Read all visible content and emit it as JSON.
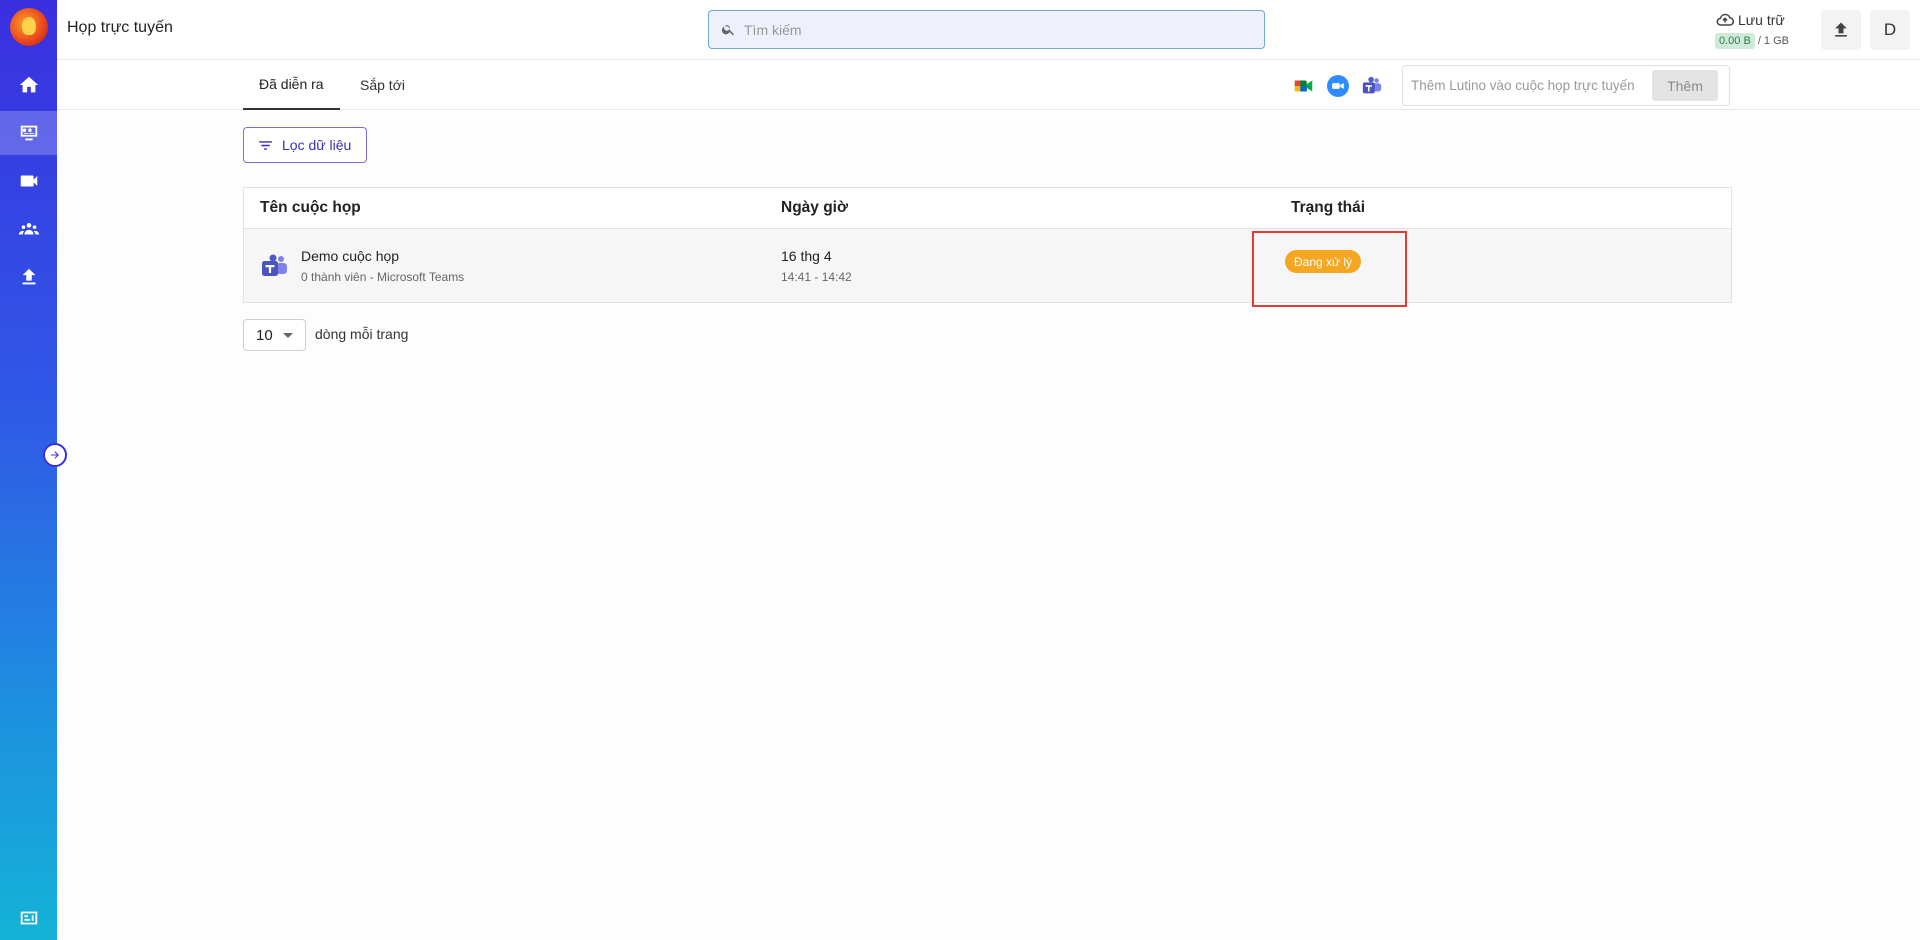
{
  "app": {
    "title": "Họp trực tuyến"
  },
  "search": {
    "placeholder": "Tìm kiếm"
  },
  "storage": {
    "label": "Lưu trữ",
    "used": "0.00 B",
    "total": "/ 1 GB"
  },
  "user": {
    "initial": "D"
  },
  "sidebar": {
    "items": [
      {
        "name": "home",
        "icon": "home-icon",
        "active": false
      },
      {
        "name": "meetings",
        "icon": "meeting-icon",
        "active": true
      },
      {
        "name": "video",
        "icon": "video-icon",
        "active": false
      },
      {
        "name": "groups",
        "icon": "people-icon",
        "active": false
      },
      {
        "name": "upload",
        "icon": "upload-icon",
        "active": false
      },
      {
        "name": "billing",
        "icon": "billing-icon",
        "active": false
      }
    ]
  },
  "tabs": [
    {
      "label": "Đã diễn ra",
      "active": true
    },
    {
      "label": "Sắp tới",
      "active": false
    }
  ],
  "services": [
    "google-meet-icon",
    "zoom-icon",
    "teams-icon"
  ],
  "add_meeting": {
    "placeholder": "Thêm Lutino vào cuộc họp trực tuyến",
    "button": "Thêm"
  },
  "filter": {
    "label": "Lọc dữ liệu"
  },
  "table": {
    "headers": [
      "Tên cuộc họp",
      "Ngày giờ",
      "Trạng thái"
    ],
    "rows": [
      {
        "name": "Demo cuộc họp",
        "subtitle": "0 thành viên - Microsoft Teams",
        "date": "16 thg 4",
        "time": "14:41 - 14:42",
        "status": "Đang xử lý"
      }
    ]
  },
  "pagination": {
    "rows_per_page": "10",
    "label": "dòng mỗi trang"
  },
  "colors": {
    "accent": "#3b2fb0",
    "status_processing": "#f5a623",
    "highlight": "#e53935"
  }
}
